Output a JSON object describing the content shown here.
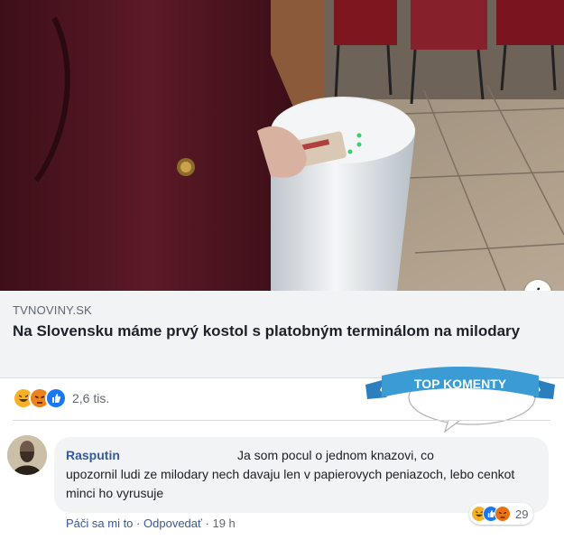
{
  "post": {
    "domain": "TVNOVINY.SK",
    "headline": "Na Slovensku máme prvý kostol s platobným terminálom na milodary",
    "info_icon": "info-icon",
    "reaction_icons": [
      "haha-reaction-icon",
      "angry-reaction-icon",
      "like-reaction-icon"
    ],
    "reaction_count": "2,6 tis."
  },
  "badge": {
    "label": "TOP KOMENTY",
    "accent": "#3a9bd5"
  },
  "comment": {
    "author": "Rasputin",
    "text_first": "Ja som pocul o jednom knazovi, co",
    "text_rest": "upozornil ludi ze milodary nech davaju len v papierovych peniazoch, lebo cenkot minci ho vyrusuje",
    "reaction_icons": [
      "haha-reaction-icon",
      "like-reaction-icon",
      "angry-reaction-icon"
    ],
    "reaction_count": "29",
    "like_label": "Páči sa mi to",
    "separator": "·",
    "reply_label": "Odpovedať",
    "time": "19 h"
  },
  "colors": {
    "link_blue": "#385898",
    "like_blue": "#1877f2",
    "haha_yellow": "#f7b125",
    "angry_orange": "#e9710f"
  }
}
